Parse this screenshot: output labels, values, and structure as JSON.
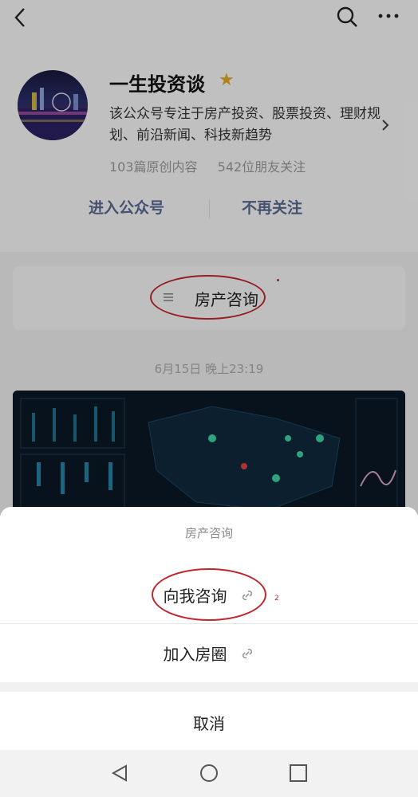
{
  "nav": {
    "back_icon": "chevron-left-icon",
    "search_icon": "search-icon",
    "more_icon": "more-dots-icon"
  },
  "profile": {
    "name": "一生投资谈",
    "star_icon": "star-icon",
    "description": "该公众号专注于房产投资、股票投资、理财规划、前沿新闻、科技新趋势",
    "original_count": "103篇原创内容",
    "followers": "542位朋友关注",
    "enter_label": "进入公众号",
    "unfollow_label": "不再关注",
    "star_color": "#e0a920",
    "link_color": "#59698f"
  },
  "menu": {
    "label": "房产咨询"
  },
  "article": {
    "date": "6月15日 晚上23:19"
  },
  "sheet": {
    "title": "房产咨询",
    "options": [
      {
        "label": "向我咨询",
        "icon": "mini-program-link-icon"
      },
      {
        "label": "加入房圈",
        "icon": "mini-program-link-icon"
      }
    ],
    "cancel": "取消",
    "annotation_mark": "2",
    "annotation_color": "#c0272d"
  },
  "system_nav": {
    "back": "triangle-back-icon",
    "home": "circle-home-icon",
    "recents": "square-recents-icon"
  }
}
